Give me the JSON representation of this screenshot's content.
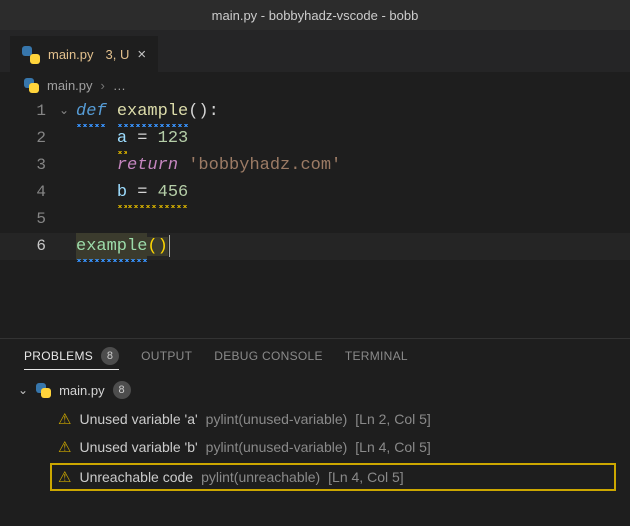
{
  "titlebar": {
    "text": "main.py - bobbyhadz-vscode - bobb"
  },
  "tab": {
    "filename": "main.py",
    "modified_suffix": "3, U"
  },
  "breadcrumb": {
    "file": "main.py",
    "separator": "›",
    "dots": "…"
  },
  "code": {
    "lines": [
      {
        "n": "1",
        "kw": "def",
        "fn": "example",
        "paren": "():"
      },
      {
        "n": "2",
        "indent": "    ",
        "var": "a",
        "op": " = ",
        "num": "123"
      },
      {
        "n": "3",
        "indent": "    ",
        "kw": "return",
        "sp": " ",
        "str": "'bobbyhadz.com'"
      },
      {
        "n": "4",
        "indent": "    ",
        "var": "b",
        "op": " = ",
        "num": "456"
      },
      {
        "n": "5"
      },
      {
        "n": "6",
        "call": "example",
        "paren": "()"
      }
    ]
  },
  "panel": {
    "tabs": {
      "problems": "PROBLEMS",
      "problems_count": "8",
      "output": "OUTPUT",
      "debug": "DEBUG CONSOLE",
      "terminal": "TERMINAL"
    },
    "file": {
      "name": "main.py",
      "count": "8"
    },
    "items": [
      {
        "msg": "Unused variable 'a'",
        "src": "pylint(unused-variable)",
        "loc": "[Ln 2, Col 5]"
      },
      {
        "msg": "Unused variable 'b'",
        "src": "pylint(unused-variable)",
        "loc": "[Ln 4, Col 5]"
      },
      {
        "msg": "Unreachable code",
        "src": "pylint(unreachable)",
        "loc": "[Ln 4, Col 5]"
      }
    ]
  }
}
